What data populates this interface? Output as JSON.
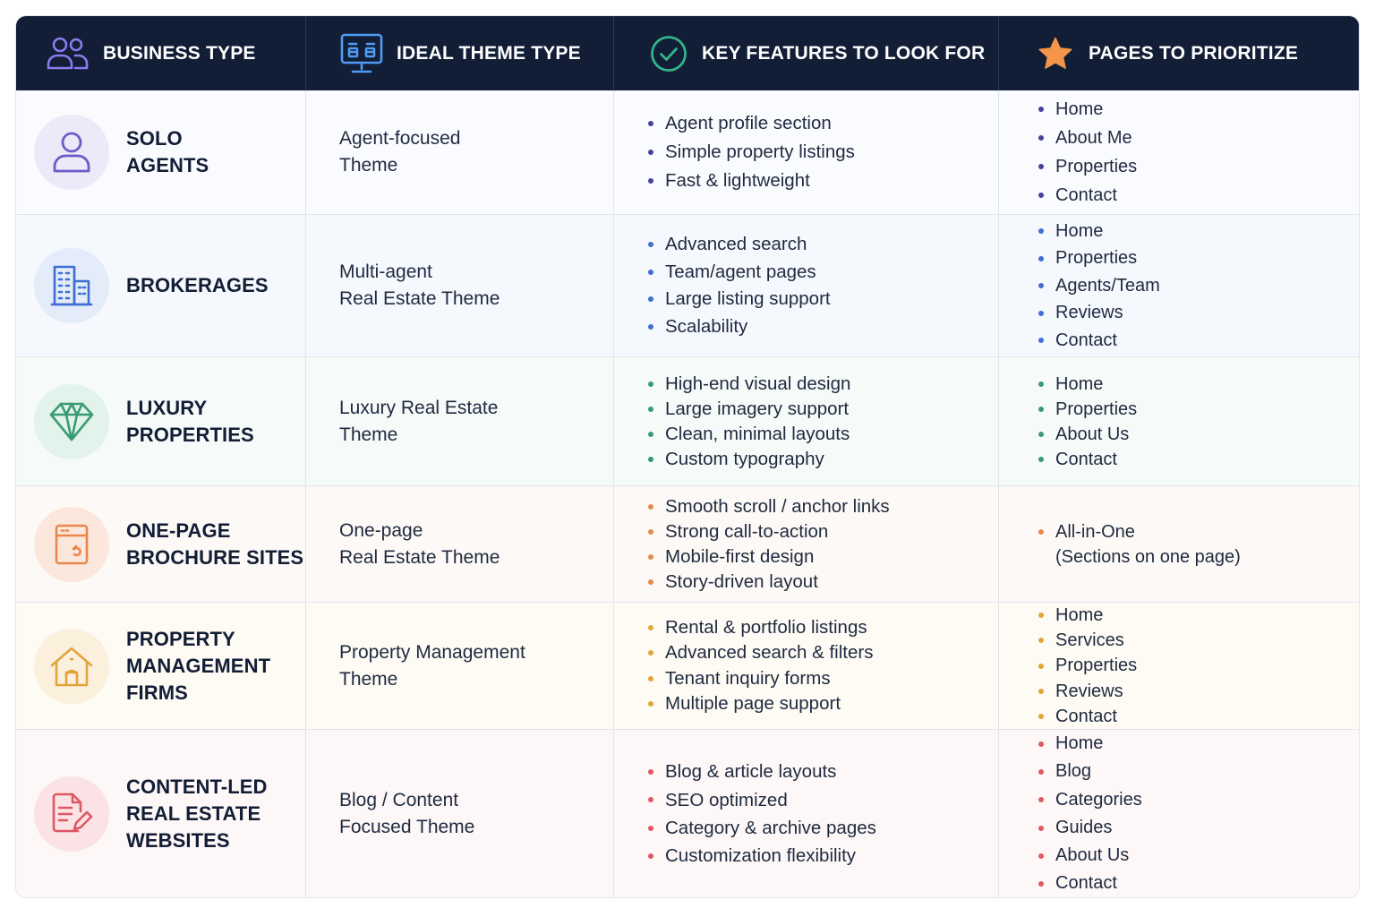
{
  "header": {
    "col1": "BUSINESS TYPE",
    "col2": "IDEAL THEME TYPE",
    "col3": "KEY FEATURES TO LOOK FOR",
    "col4": "PAGES TO PRIORITIZE",
    "icons": [
      "users-icon",
      "monitor-layout-icon",
      "check-circle-icon",
      "star-icon"
    ]
  },
  "colors": {
    "header_bg": "#121d36",
    "solo": "#4a3f9b",
    "brokerages": "#3e6fd1",
    "luxury": "#3a9b72",
    "onepage": "#e9874a",
    "property": "#e3a43b",
    "content": "#de5864"
  },
  "rows": [
    {
      "icon": "user-icon",
      "business": [
        "SOLO",
        "AGENTS"
      ],
      "theme": [
        "Agent-focused",
        "Theme"
      ],
      "features": [
        "Agent profile section",
        "Simple property listings",
        "Fast & lightweight"
      ],
      "pages": [
        "Home",
        "About Me",
        "Properties",
        "Contact"
      ]
    },
    {
      "icon": "building-icon",
      "business": [
        "BROKERAGES"
      ],
      "theme": [
        "Multi-agent",
        "Real Estate Theme"
      ],
      "features": [
        "Advanced search",
        "Team/agent pages",
        "Large listing support",
        "Scalability"
      ],
      "pages": [
        "Home",
        "Properties",
        "Agents/Team",
        "Reviews",
        "Contact"
      ]
    },
    {
      "icon": "diamond-icon",
      "business": [
        "LUXURY",
        "PROPERTIES"
      ],
      "theme": [
        "Luxury Real Estate",
        "Theme"
      ],
      "features": [
        "High-end visual design",
        "Large imagery support",
        "Clean, minimal layouts",
        "Custom typography"
      ],
      "pages": [
        "Home",
        "Properties",
        "About Us",
        "Contact"
      ]
    },
    {
      "icon": "brochure-icon",
      "business": [
        "ONE-PAGE",
        "BROCHURE SITES"
      ],
      "theme": [
        "One-page",
        "Real Estate Theme"
      ],
      "features": [
        "Smooth scroll / anchor links",
        "Strong call-to-action",
        "Mobile-first design",
        "Story-driven layout"
      ],
      "pages": [
        "All-in-One",
        "(Sections on one page)"
      ]
    },
    {
      "icon": "house-icon",
      "business": [
        "PROPERTY",
        "MANAGEMENT",
        "FIRMS"
      ],
      "theme": [
        "Property Management",
        "Theme"
      ],
      "features": [
        "Rental & portfolio listings",
        "Advanced search & filters",
        "Tenant inquiry forms",
        "Multiple page support"
      ],
      "pages": [
        "Home",
        "Services",
        "Properties",
        "Reviews",
        "Contact"
      ]
    },
    {
      "icon": "document-pen-icon",
      "business": [
        "CONTENT-LED",
        "REAL ESTATE",
        "WEBSITES"
      ],
      "theme": [
        "Blog / Content",
        "Focused Theme"
      ],
      "features": [
        "Blog & article layouts",
        "SEO optimized",
        "Category & archive pages",
        "Customization flexibility"
      ],
      "pages": [
        "Home",
        "Blog",
        "Categories",
        "Guides",
        "About Us",
        "Contact"
      ]
    }
  ]
}
